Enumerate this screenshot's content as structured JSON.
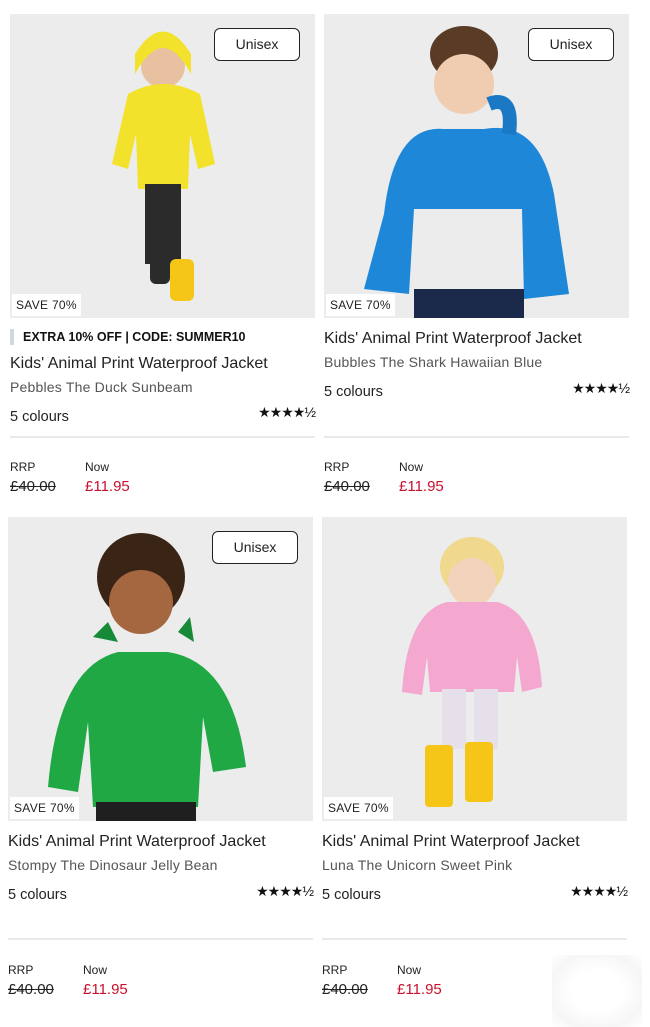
{
  "products": [
    {
      "badge": "Unisex",
      "save_label": "SAVE 70%",
      "promo": "EXTRA 10% OFF | CODE: SUMMER10",
      "title": "Kids' Animal Print Waterproof Jacket",
      "variant": "Pebbles The Duck Sunbeam",
      "colours": "5 colours",
      "rating_stars": "★★★★½",
      "rating_value": 4.5,
      "rrp_label": "RRP",
      "rrp_price": "£40.00",
      "now_label": "Now",
      "now_price": "£11.95",
      "jacket_color": "#f3e22b"
    },
    {
      "badge": "Unisex",
      "save_label": "SAVE 70%",
      "title": "Kids' Animal Print Waterproof Jacket",
      "variant": "Bubbles The Shark Hawaiian Blue",
      "colours": "5 colours",
      "rating_stars": "★★★★½",
      "rating_value": 4.5,
      "rrp_label": "RRP",
      "rrp_price": "£40.00",
      "now_label": "Now",
      "now_price": "£11.95",
      "jacket_color": "#1e87d8"
    },
    {
      "badge": "Unisex",
      "save_label": "SAVE 70%",
      "title": "Kids' Animal Print Waterproof Jacket",
      "variant": "Stompy The Dinosaur Jelly Bean",
      "colours": "5 colours",
      "rating_stars": "★★★★½",
      "rating_value": 4.5,
      "rrp_label": "RRP",
      "rrp_price": "£40.00",
      "now_label": "Now",
      "now_price": "£11.95",
      "jacket_color": "#1fa844"
    },
    {
      "save_label": "SAVE 70%",
      "title": "Kids' Animal Print Waterproof Jacket",
      "variant": "Luna The Unicorn Sweet Pink",
      "colours": "5 colours",
      "rating_stars": "★★★★½",
      "rating_value": 4.5,
      "rrp_label": "RRP",
      "rrp_price": "£40.00",
      "now_label": "Now",
      "now_price": "£11.95",
      "jacket_color": "#f4a8cf"
    }
  ],
  "colors": {
    "price_now": "#c8102e",
    "image_bg": "#ececec"
  }
}
